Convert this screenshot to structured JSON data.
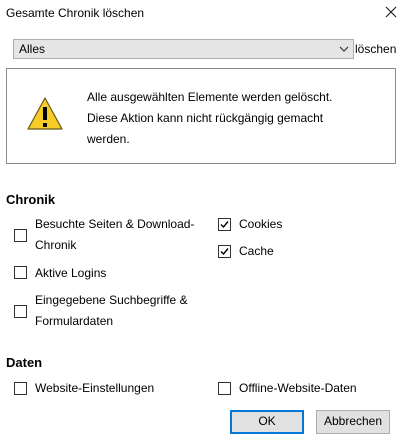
{
  "dialog": {
    "title": "Gesamte Chronik löschen"
  },
  "range": {
    "selected": "Alles",
    "suffix": "löschen"
  },
  "warning": {
    "lines": [
      "Alle ausgewählten Elemente werden gelöscht.",
      "Diese Aktion kann nicht rückgängig gemacht",
      "werden."
    ]
  },
  "history_section": {
    "heading": "Chronik",
    "items": [
      {
        "label_lines": [
          "Besuchte Seiten & Download-",
          "Chronik"
        ],
        "checked": false
      },
      {
        "label_lines": [
          "Aktive Logins"
        ],
        "checked": false
      },
      {
        "label_lines": [
          "Eingegebene Suchbegriffe &",
          "Formulardaten"
        ],
        "checked": false
      },
      {
        "label_lines": [
          "Cookies"
        ],
        "checked": true
      },
      {
        "label_lines": [
          "Cache"
        ],
        "checked": true
      }
    ]
  },
  "data_section": {
    "heading": "Daten",
    "items": [
      {
        "label_lines": [
          "Website-Einstellungen"
        ],
        "checked": false
      },
      {
        "label_lines": [
          "Offline-Website-Daten"
        ],
        "checked": false
      }
    ]
  },
  "buttons": {
    "ok": "OK",
    "cancel": "Abbrechen"
  },
  "colors": {
    "focus_border": "#0078d7",
    "warning_yellow": "#f5cc28"
  }
}
